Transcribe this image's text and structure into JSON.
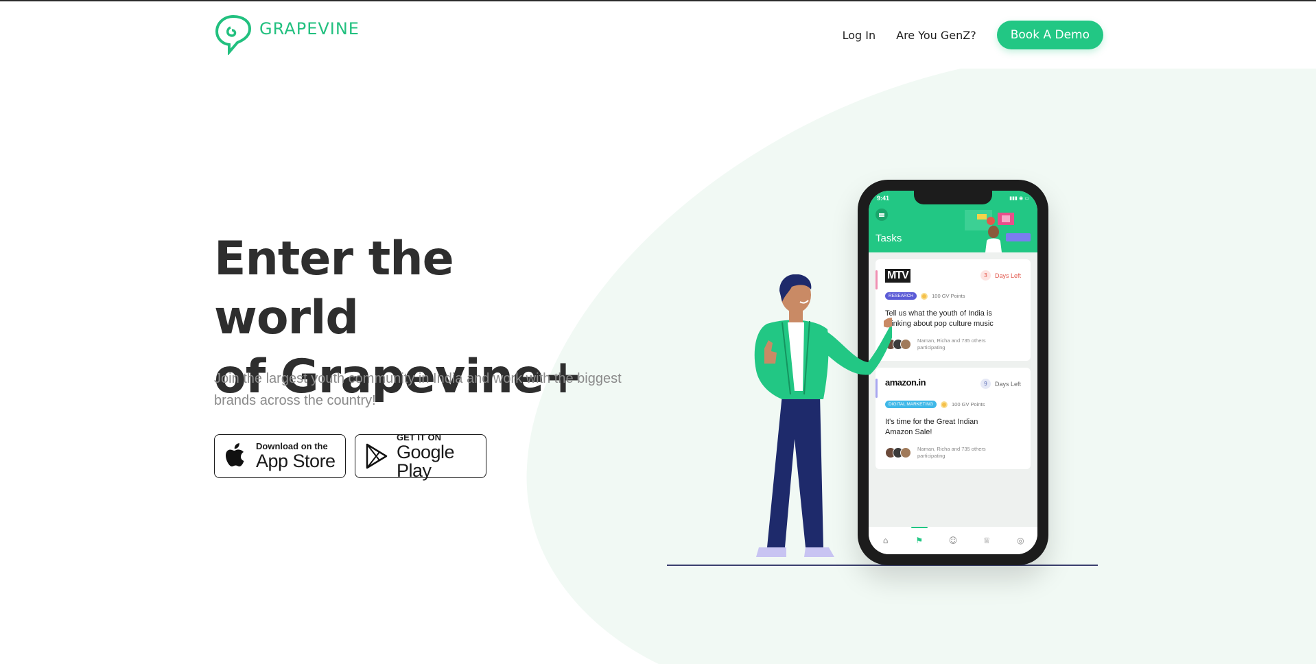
{
  "brand": {
    "name": "GRAPEVINE",
    "color": "#22c07f"
  },
  "nav": {
    "login": "Log In",
    "genz": "Are You GenZ?",
    "demo": "Book A Demo"
  },
  "hero": {
    "title_line1": "Enter the world",
    "title_line2": "of Grapevine+",
    "subtitle": "Join the largest youth community in India and work with the biggest brands across the country!"
  },
  "stores": {
    "apple": {
      "small": "Download on the",
      "big": "App Store",
      "icon": "apple-icon"
    },
    "google": {
      "small": "GET IT ON",
      "big": "Google Play",
      "icon": "google-play-icon"
    }
  },
  "phone": {
    "time": "9:41",
    "screen_title": "Tasks",
    "cards": [
      {
        "brand": "MTV",
        "days": "3",
        "days_label": "Days Left",
        "days_color": "#e2574c",
        "tag": "RESEARCH",
        "tag_color": "#5b5bd6",
        "points": "100 GV Points",
        "text": "Tell us what the youth of India is thinking about pop culture music",
        "participants": "Naman, Richa and 735 others participating",
        "bar_color": "#f08fb2"
      },
      {
        "brand": "amazon.in",
        "days": "9",
        "days_label": "Days Left",
        "days_color": "#5a6bb5",
        "tag": "DIGITAL MARKETING",
        "tag_color": "#3fb8e8",
        "points": "100 GV Points",
        "text": "It's time for the Great Indian Amazon Sale!",
        "participants": "Naman, Richa and 735 others participating",
        "bar_color": "#a8a6f0"
      }
    ],
    "tabs": [
      "home-icon",
      "flag-icon",
      "user-icon",
      "trophy-icon",
      "settings-icon"
    ]
  },
  "colors": {
    "accent": "#22c784",
    "bg_blob": "#f1f9f4"
  }
}
